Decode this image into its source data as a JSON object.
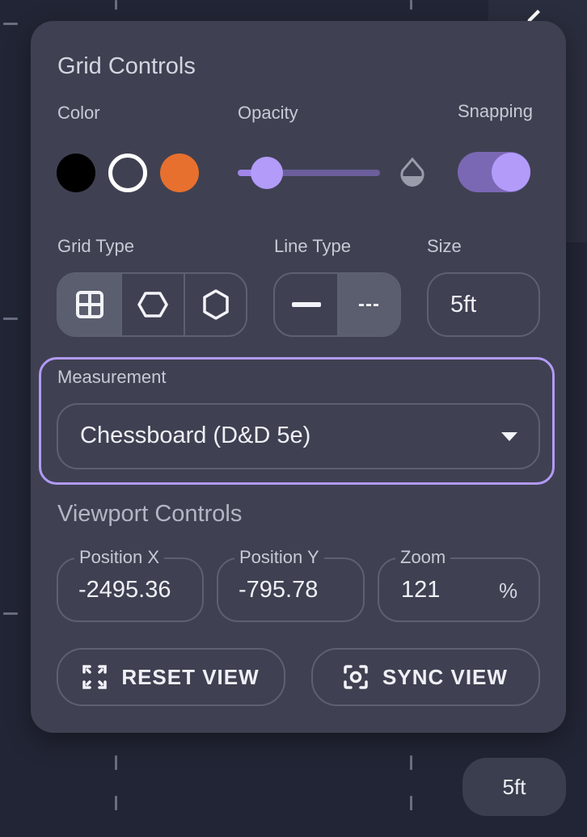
{
  "panel": {
    "grid_controls_title": "Grid Controls",
    "color_label": "Color",
    "opacity_label": "Opacity",
    "snapping_label": "Snapping",
    "colors": [
      {
        "name": "black",
        "hex": "#000000"
      },
      {
        "name": "white",
        "hex": "#ffffff"
      },
      {
        "name": "orange",
        "hex": "#e8702e"
      }
    ],
    "opacity_value": 0.2,
    "opacity_icon": "opacity-icon",
    "snapping_enabled": true,
    "grid_type_label": "Grid Type",
    "grid_types": [
      "square",
      "hex-horizontal",
      "hex-vertical"
    ],
    "grid_type_selected": "square",
    "line_type_label": "Line Type",
    "line_types": [
      "solid",
      "dashed"
    ],
    "line_type_selected": "dashed",
    "dashed_glyph": "---",
    "size_label": "Size",
    "size_value": "5ft",
    "measurement_label": "Measurement",
    "measurement_value": "Chessboard (D&D 5e)",
    "viewport_controls_title": "Viewport Controls",
    "position_x_label": "Position X",
    "position_x_value": "-2495.36",
    "position_y_label": "Position Y",
    "position_y_value": "-795.78",
    "zoom_label": "Zoom",
    "zoom_value": "121",
    "zoom_unit": "%",
    "reset_view_label": "RESET VIEW",
    "sync_view_label": "SYNC VIEW"
  },
  "badge": {
    "label": "5ft"
  },
  "accent_color": "#b29af6"
}
